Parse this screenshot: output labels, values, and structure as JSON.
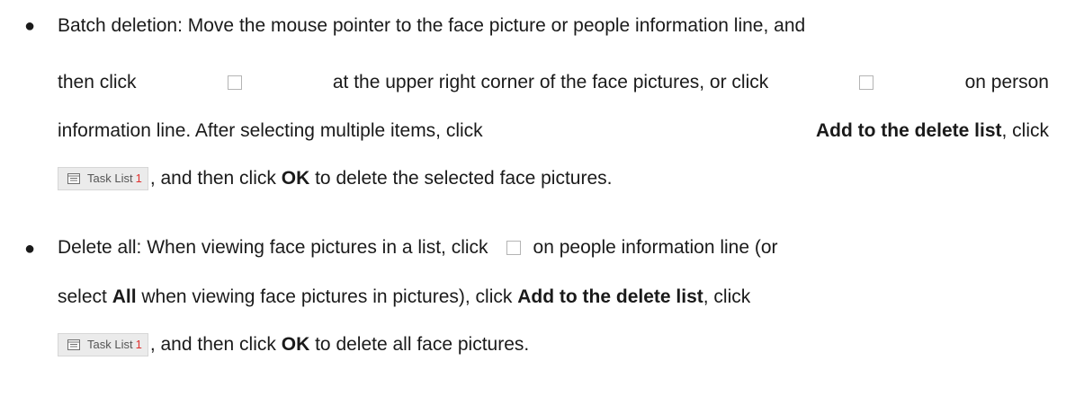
{
  "section1": {
    "bullet": "●",
    "line1": "Batch deletion: Move the mouse pointer to the face picture or people information line, and",
    "line2_part1": "then click",
    "line2_part2": "at the upper right corner of the face pictures, or click",
    "line2_part3": "on person",
    "line3_part1": "information line. After selecting multiple items, click",
    "line3_bold": "Add to the delete list",
    "line3_part2": ", click",
    "line4_part1": ", and then click",
    "line4_bold": "OK",
    "line4_part2": "to delete the selected face pictures."
  },
  "section2": {
    "bullet": "●",
    "line1_part1": "Delete all: When viewing face pictures in a list, click",
    "line1_part2": "on people information line (or",
    "line2_part1": "select",
    "line2_bold": "All",
    "line2_part2": "when viewing face pictures in pictures), click",
    "line2_bold2": "Add to the delete list",
    "line2_part3": ", click",
    "line3_part1": ", and then click",
    "line3_bold": "OK",
    "line3_part2": "to delete all face pictures."
  },
  "task_list_button": {
    "label": "Task List",
    "count": "1",
    "icon": "list-icon"
  },
  "colors": {
    "text": "#1a1a1a",
    "task_count": "#e0302e",
    "button_bg": "#ebebeb"
  }
}
